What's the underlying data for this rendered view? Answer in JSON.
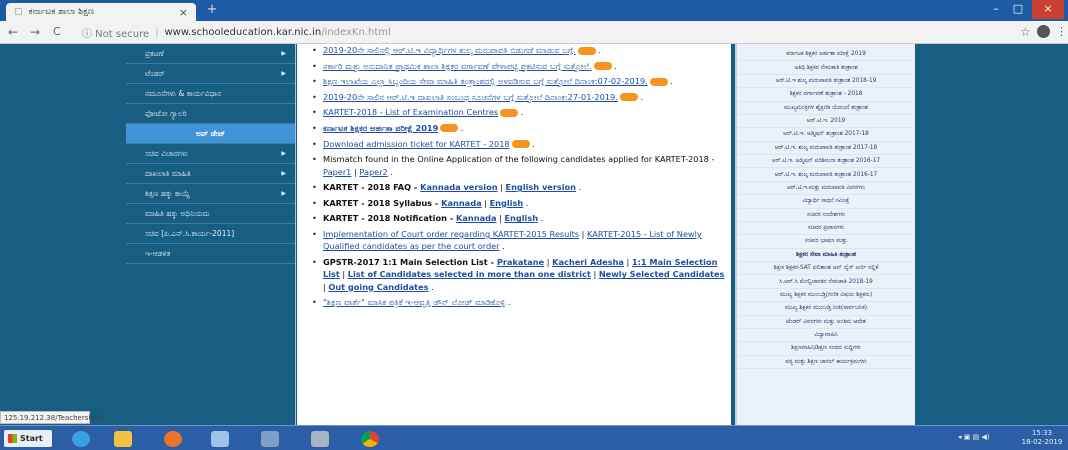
{
  "browser": {
    "tab_title": "ಕರ್ನಾಟಕ ಶಾಲಾ ಶಿಕ್ಷಣ",
    "tab_close": "×",
    "new_tab": "+",
    "window_minimize": "–",
    "window_maximize": "□",
    "window_close": "×",
    "nav_back": "←",
    "nav_forward": "→",
    "nav_reload": "C",
    "security_label": "ⓘ Not secure",
    "url_host": "www.schooleducation.kar.nic.in",
    "url_path": "/indexKn.html",
    "star": "☆",
    "menu": "⋮"
  },
  "sidebar": {
    "items": [
      {
        "label": "ಪ್ರಕಟಣೆ",
        "arrow": "▶"
      },
      {
        "label": "ಟೆಂಡರ್",
        "arrow": "▶"
      },
      {
        "label": "ನಮೂನೆಗಳು & ಕಾರ್ಯವಿಧಾನ",
        "arrow": ""
      },
      {
        "label": "ಫೋಟೋ ಗ್ಯಾಲರಿ",
        "arrow": ""
      },
      {
        "label": "ಅಪ್ ಡೇಟ್",
        "arrow": ""
      },
      {
        "label": "ಸಚಿವ ವಿಚಾರಗಳು",
        "arrow": "▶"
      },
      {
        "label": "ದಾಖಲಾತಿ ಮಾಹಿತಿ",
        "arrow": "▶"
      },
      {
        "label": "ಶಿಕ್ಷಣ ಹಕ್ಕು ಕಾಯ್ದೆ",
        "arrow": "▶"
      },
      {
        "label": "ಮಾಹಿತಿ ಹಕ್ಕು ಅಧಿನಿಯಮ",
        "arrow": ""
      },
      {
        "label": "ಸಚಿವ [ಪಿ.ಎನ್.ಸಿ.ಕಾರ್ಯ-2011]",
        "arrow": ""
      },
      {
        "label": "ಇ-ಆಡಳಿತ",
        "arrow": ""
      }
    ]
  },
  "content": {
    "items": [
      {
        "text": "2019-20ನೇ ಸಾಲಿನಲ್ಲಿ ಆರ್.ಟಿ.ಇ ವಿದ್ಯಾರ್ಥಿಗಳ ಶುಲ್ಕ ಮರುಪಾವತಿ ಬಿಡುಗಡೆ ಮಾಡುವ ಬಗ್ಗೆ."
      },
      {
        "text": "ಸರ್ಕಾರಿ ಮತ್ತು ಅನುದಾನಿತ ಪ್ರಾಥಮಿಕ ಶಾಲಾ ಶಿಕ್ಷಕರ ವರ್ಗಾವಣೆ ವೇಳಾಪಟ್ಟಿ ಪ್ರಕಟಿಸುವ ಬಗ್ಗೆ ಸುತ್ತೋಲೆ."
      },
      {
        "text": "ಶಿಕ್ಷಣ ಇಲಾಖೆಯ ಎಲ್ಲಾ ಸಿಬ್ಬಂದಿಯ ಸೇವಾ ಮಾಹಿತಿ ತಂತ್ರಾಂಶದಲ್ಲಿ ಅಳವಡಿಸುವ ಬಗ್ಗೆ ಸುತ್ತೋಲೆ ದಿನಾಂಕ:07-02-2019."
      },
      {
        "text": "2019-20ನೇ ಸಾಲಿನ ಆರ್.ಟಿ.ಇ ದಾಖಲಾತಿ ಸಂಬಂಧ ಸೂಚನೆಗಳ ಬಗ್ಗೆ ಸುತ್ತೋಲೆ ದಿನಾಂಕ:27-01-2019."
      },
      {
        "link": "KARTET-2018 - List of Examination Centres"
      },
      {
        "link": "ಕರ್ನಾಟಕ ಶಿಕ್ಷಕರ ಅರ್ಹತಾ ಪರೀಕ್ಷೆ 2019"
      },
      {
        "link": "Download admission ticket for KARTET - 2018"
      },
      {
        "text": "Mismatch found in the Online Application of the following candidates applied for KARTET-2018 - ",
        "links": [
          "Paper1",
          "Paper2"
        ]
      },
      {
        "bold": "KARTET - 2018 FAQ - ",
        "links": [
          "Kannada version",
          "English version"
        ]
      },
      {
        "bold": "KARTET - 2018 Syllabus - ",
        "links": [
          "Kannada",
          "English"
        ]
      },
      {
        "bold": "KARTET - 2018 Notification - ",
        "links": [
          "Kannada",
          "English"
        ]
      },
      {
        "links": [
          "Implementation of Court order regarding KARTET-2015 Results",
          "KARTET-2015 - List of Newly Qualified candidates as per the court order"
        ]
      },
      {
        "bold": "GPSTR-2017 1:1 Main Selection List - ",
        "links": [
          "Prakatane",
          "Kacheri Adesha",
          "1:1 Main Selection List",
          "List of Candidates selected in more than one district",
          "Newly Selected Candidates",
          "Out going Candidates"
        ]
      },
      {
        "link": "\"ಶಿಕ್ಷಣ ವಾರ್ತೆ\" ಮಾಸಿಕ ಪತ್ರಿಕೆ ಇ-ಆವೃತ್ತಿ ಡೌನ್ ಲೋಡ್ ಮಾಡಿಕೊಳ್ಳಿ"
      }
    ]
  },
  "right_links": [
    {
      "label": "ಕರ್ನಾಟಕ ಶಿಕ್ಷಕರ ಅರ್ಹತಾ ಪರೀಕ್ಷೆ 2019",
      "bold": false
    },
    {
      "label": "ಅತಿಥಿ ಶಿಕ್ಷಕರ ನೇಮಕಾತಿ ತಂತ್ರಾಂಶ",
      "bold": false
    },
    {
      "label": "ಆರ್.ಟಿ.ಇ ಶುಲ್ಕ ಮರುಪಾವತಿ ತಂತ್ರಾಂಶ 2018-19",
      "bold": false
    },
    {
      "label": "ಶಿಕ್ಷಕರ ವರ್ಗಾವಣೆ ತಂತ್ರಾಂಶ - 2018",
      "bold": false
    },
    {
      "label": "ಮುಖ್ಯಮಂತ್ರಿಗಳ ಶೈಕ್ಷಣಿಕ ಯೋಜನೆ ತಂತ್ರಾಂಶ",
      "bold": false
    },
    {
      "label": "ಆರ್.ಟಿ.ಇ. 2019",
      "bold": false
    },
    {
      "label": "ಆರ್.ಟಿ.ಇ. ಅಡ್ಮಿಷನ್ ತಂತ್ರಾಂಶ 2017-18",
      "bold": false
    },
    {
      "label": "ಆರ್.ಟಿ.ಇ. ಶುಲ್ಕ ಮರುಪಾವತಿ ತಂತ್ರಾಂಶ 2017-18",
      "bold": false
    },
    {
      "label": "ಆರ್.ಟಿ.ಇ. ಅಡ್ಮಿಷನ್ ಪರಿಶೀಲನಾ ತಂತ್ರಾಂಶ 2016-17",
      "bold": false
    },
    {
      "label": "ಆರ್.ಟಿ.ಇ. ಶುಲ್ಕ ಮರುಪಾವತಿ ತಂತ್ರಾಂಶ 2016-17",
      "bold": false
    },
    {
      "label": "ಆರ್.ಟಿ.ಇ.ಮತ್ತು ಮರುಪಾವತಿ ವಿವರಗಳು",
      "bold": false
    },
    {
      "label": "ವಿದ್ಯಾರ್ಥಿ ಸಾಧನೆ ಸಮೀಕ್ಷೆ",
      "bold": false
    },
    {
      "label": "ಸಚಿವರ ಸಂದೇಶಗಳು",
      "bold": false
    },
    {
      "label": "ಸಚಿವರ ಪ್ರವಾಸಗಳು",
      "bold": false
    },
    {
      "label": "ಸಚಿವರ ಭಾಷಣ ಮತ್ತು",
      "bold": false
    },
    {
      "label": "ಶಿಕ್ಷಕರ ಸೇವಾ ಮಾಹಿತಿ ತಂತ್ರಾಂಶ",
      "bold": true
    },
    {
      "label": "ಶಿಕ್ಷಣ ಶಿಕ್ಷಕರ-SAT ಫಲಿತಾಂಶ ಆನ್ ಲೈನ್ ಅರ್ಜಿ ಸಲ್ಲಿಕೆ",
      "bold": false
    },
    {
      "label": "ಸಿ.ಆರ್.ಸಿ ಮೇಲ್ವಿಚಾರಕರ ನೇಮಕಾತಿ 2018-19",
      "bold": false
    },
    {
      "label": "ಮುಖ್ಯ ಶಿಕ್ಷಕರ ಮುಂಬಡ್ತಿ(ಗಣಿತ ವಿಷಯ ಶಿಕ್ಷಕರು)",
      "bold": false
    },
    {
      "label": "ಮುಖ್ಯ ಶಿಕ್ಷಕರ ಮುಂಬಡ್ತಿ ನೀತಿ(ಸಾರ್ವಜನಿಕ)",
      "bold": false
    },
    {
      "label": "ಟೆಂಡರ್ ವಿವರಗಳು ಮತ್ತು ಅಂತಿಮ ಆದೇಶ",
      "bold": false
    },
    {
      "label": "ವಿದ್ಯಾವಾಹಿನಿ",
      "bold": false
    },
    {
      "label": "ಶಿಕ್ಷಣವಾಹಿನಿ/ಶಿಕ್ಷಣ ಸಂಪದ ಸುದ್ದಿಗಳು",
      "bold": false
    },
    {
      "label": "ಪಠ್ಯ ಮತ್ತು ಶಿಕ್ಷಣ ಚಾನಲ್ ಕಾರ್ಯಕ್ರಮಗಳು",
      "bold": false
    }
  ],
  "status_url": "125.19.212.38/TeachersInfo/",
  "taskbar": {
    "start_label": "Start",
    "clock_time": "15:33",
    "clock_date": "18-02-2019",
    "icons": [
      "ie-icon",
      "folder-icon",
      "firefox-icon",
      "network-icon",
      "window-icon",
      "tool-icon",
      "chrome-icon"
    ]
  },
  "colors": {
    "page_bg": "#175e82",
    "active_menu": "#3f93d6",
    "link": "#1e4fa4",
    "new_badge": "#f7941d",
    "taskbar": "#2b5ea4"
  }
}
